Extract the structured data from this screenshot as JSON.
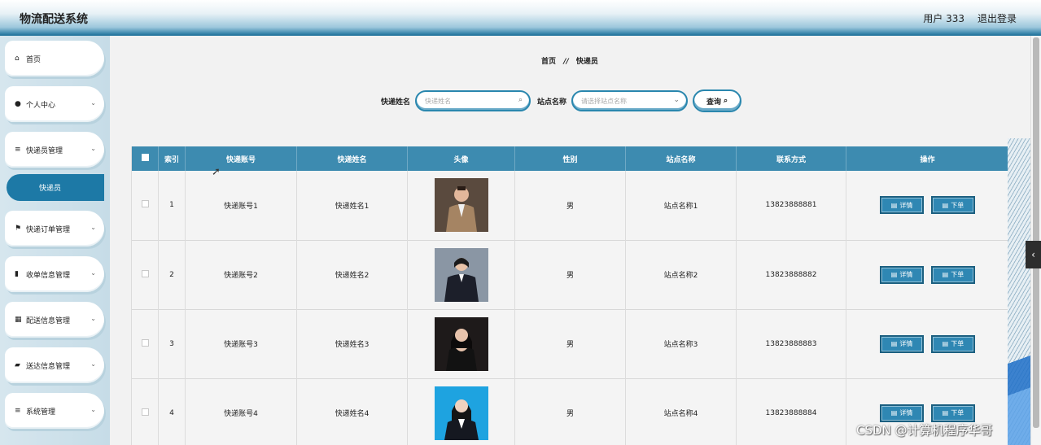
{
  "header": {
    "title": "物流配送系统",
    "user": "用户 333",
    "logout": "退出登录"
  },
  "sidebar": {
    "items": [
      {
        "label": "首页",
        "icon": "home-icon"
      },
      {
        "label": "个人中心",
        "icon": "user-icon"
      },
      {
        "label": "快递员管理",
        "icon": "list-icon"
      },
      {
        "label": "快递订单管理",
        "icon": "flag-icon"
      },
      {
        "label": "收单信息管理",
        "icon": "bar-chart-icon"
      },
      {
        "label": "配送信息管理",
        "icon": "grid-icon"
      },
      {
        "label": "送达信息管理",
        "icon": "edit-icon"
      },
      {
        "label": "系统管理",
        "icon": "list-icon"
      }
    ],
    "submenu": "快递员"
  },
  "breadcrumb": {
    "home": "首页",
    "sep": "//",
    "current": "快递员"
  },
  "search": {
    "name_label": "快递姓名",
    "name_placeholder": "快递姓名",
    "station_label": "站点名称",
    "station_placeholder": "请选择站点名称",
    "query_label": "查询"
  },
  "table": {
    "headers": [
      "索引",
      "快递账号",
      "快递姓名",
      "头像",
      "性别",
      "站点名称",
      "联系方式",
      "操作"
    ],
    "rows": [
      {
        "index": "1",
        "account": "快递账号1",
        "name": "快递姓名1",
        "gender": "男",
        "station": "站点名称1",
        "phone": "13823888881"
      },
      {
        "index": "2",
        "account": "快递账号2",
        "name": "快递姓名2",
        "gender": "男",
        "station": "站点名称2",
        "phone": "13823888882"
      },
      {
        "index": "3",
        "account": "快递账号3",
        "name": "快递姓名3",
        "gender": "男",
        "station": "站点名称3",
        "phone": "13823888883"
      },
      {
        "index": "4",
        "account": "快递账号4",
        "name": "快递姓名4",
        "gender": "男",
        "station": "站点名称4",
        "phone": "13823888884"
      }
    ],
    "detail_label": "详情",
    "order_label": "下单"
  },
  "watermark": "CSDN @计算机程序华哥",
  "colors": {
    "accent": "#1d79a6",
    "header_row": "#3d8bb0",
    "button": "#2f87b3"
  }
}
